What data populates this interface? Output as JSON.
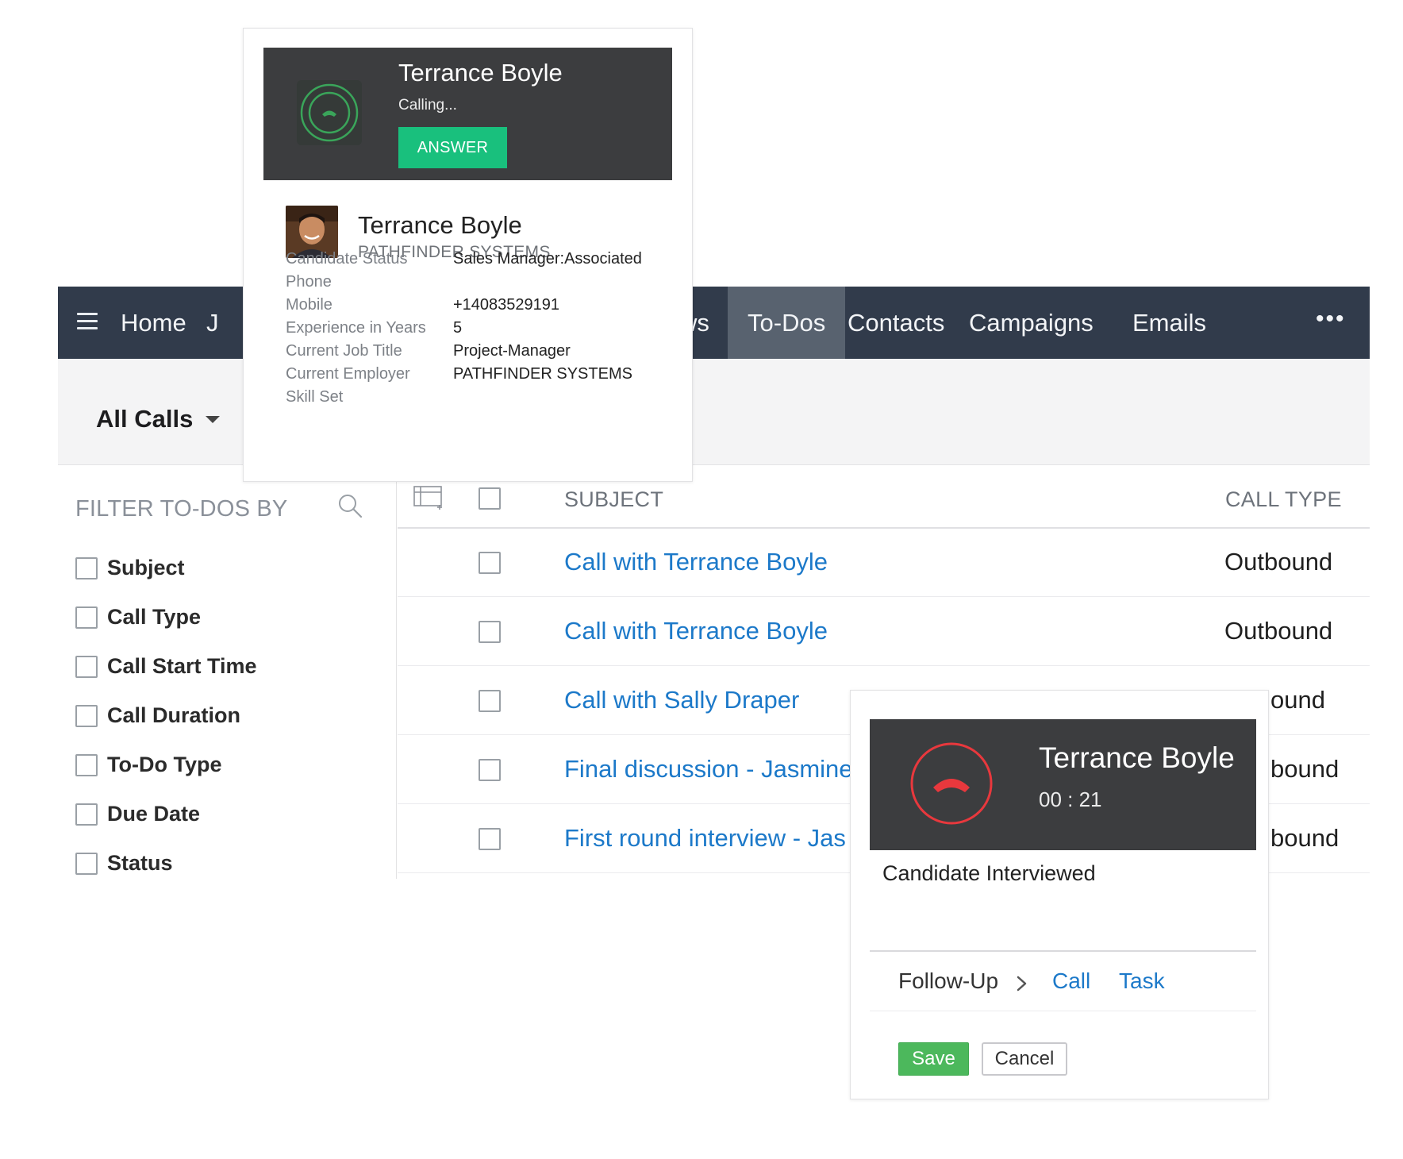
{
  "nav": {
    "items": [
      "Home",
      "J",
      "ws",
      "To-Dos",
      "Contacts",
      "Campaigns",
      "Emails"
    ],
    "more_label": "•••",
    "active_tab": "To-Dos"
  },
  "view": {
    "title": "All Calls"
  },
  "filter": {
    "title": "FILTER TO-DOS BY",
    "items": [
      "Subject",
      "Call Type",
      "Call Start Time",
      "Call Duration",
      "To-Do Type",
      "Due Date",
      "Status"
    ]
  },
  "table": {
    "headers": {
      "subject": "SUBJECT",
      "call_type": "CALL TYPE"
    },
    "rows": [
      {
        "subject": "Call with Terrance Boyle",
        "call_type": "Outbound"
      },
      {
        "subject": "Call with Terrance Boyle",
        "call_type": "Outbound"
      },
      {
        "subject": "Call with Sally Draper",
        "call_type": "ound"
      },
      {
        "subject": "Final discussion - Jasmine",
        "call_type": "bound"
      },
      {
        "subject": "First round interview - Jas",
        "call_type": "bound"
      }
    ]
  },
  "incoming_call": {
    "name": "Terrance Boyle",
    "status": "Calling...",
    "answer_label": "ANSWER",
    "contact_name": "Terrance Boyle",
    "company": "PATHFINDER SYSTEMS",
    "details": [
      {
        "label": "Candidate Status",
        "value": "Sales Manager:Associated"
      },
      {
        "label": "Phone",
        "value": ""
      },
      {
        "label": "Mobile",
        "value": "+14083529191"
      },
      {
        "label": "Experience in Years",
        "value": "5"
      },
      {
        "label": "Current Job Title",
        "value": "Project-Manager"
      },
      {
        "label": "Current Employer",
        "value": "PATHFINDER SYSTEMS"
      },
      {
        "label": "Skill Set",
        "value": ""
      }
    ]
  },
  "active_call": {
    "name": "Terrance Boyle",
    "timer": "00 : 21",
    "notes": "Candidate Interviewed",
    "followup_label": "Follow-Up",
    "followup_call": "Call",
    "followup_task": "Task",
    "save_label": "Save",
    "cancel_label": "Cancel"
  },
  "colors": {
    "nav_bg": "#313b4b",
    "nav_active": "#58626f",
    "link": "#1c79c9",
    "answer_green": "#19c07d",
    "save_green": "#4cb85c",
    "hangup_red": "#e8383d",
    "ring_green": "#3aa55a"
  },
  "icons": {
    "menu": "hamburger-icon",
    "more": "more-icon",
    "search": "search-icon",
    "columns": "column-settings-icon",
    "ring": "phone-ring-icon",
    "hangup": "hangup-icon",
    "chevron": "chevron-right-icon"
  }
}
